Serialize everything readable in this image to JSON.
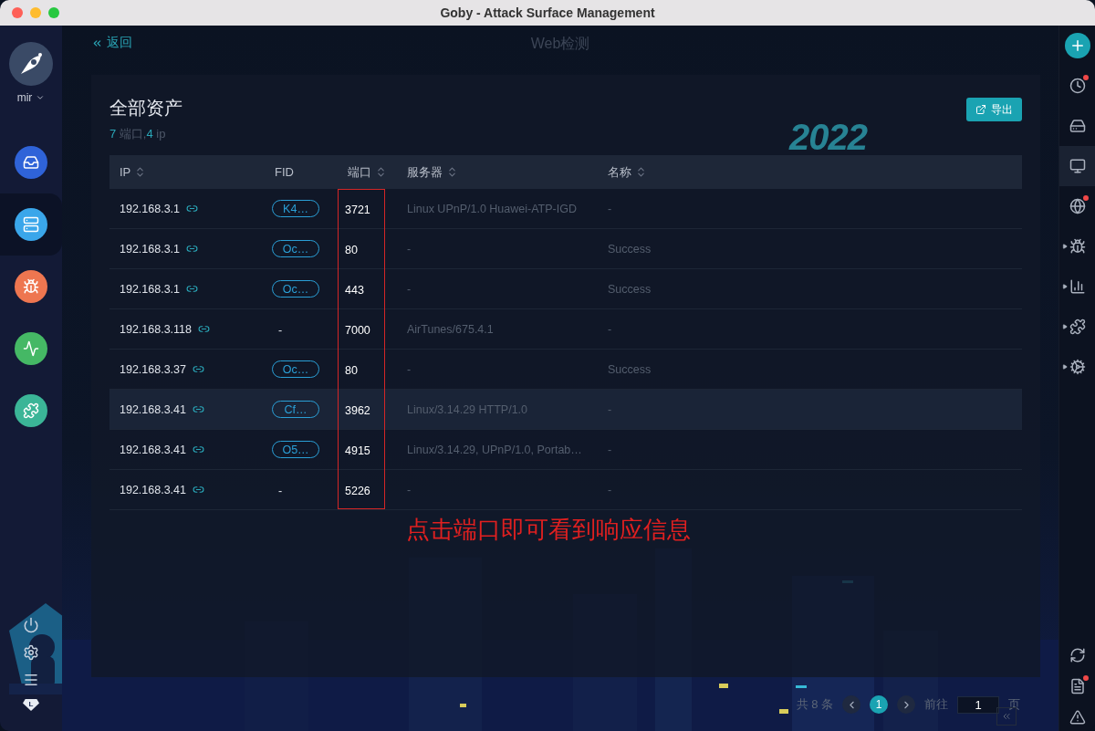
{
  "window": {
    "title": "Goby - Attack Surface Management"
  },
  "left_sidebar": {
    "user": {
      "name": "mir"
    },
    "nav": [
      {
        "kind": "scan",
        "color": "#2f63d8",
        "selected": false
      },
      {
        "kind": "assets",
        "color": "#3aa6ea",
        "selected": true
      },
      {
        "kind": "vuln",
        "color": "#ee7650",
        "selected": false
      },
      {
        "kind": "chart",
        "color": "#45b865",
        "selected": false
      },
      {
        "kind": "plugin",
        "color": "#3bb597",
        "selected": false
      }
    ],
    "badge": "L"
  },
  "header": {
    "back": "返回",
    "title": "Web检测"
  },
  "panel": {
    "title": "全部资产",
    "summary": {
      "port_count": "7",
      "port_label": "端口,",
      "ip_count": "4",
      "ip_label": "ip"
    },
    "export_button": "导出",
    "banner": "2022",
    "table": {
      "columns": [
        {
          "label": "IP",
          "sortable": true
        },
        {
          "label": "FID",
          "sortable": false
        },
        {
          "label": "端口",
          "sortable": true
        },
        {
          "label": "服务器",
          "sortable": true
        },
        {
          "label": "名称",
          "sortable": true
        }
      ],
      "rows": [
        {
          "ip": "192.168.3.1",
          "fid": "K4…",
          "port": "3721",
          "server": "Linux UPnP/1.0 Huawei-ATP-IGD",
          "name": "-",
          "selected": false
        },
        {
          "ip": "192.168.3.1",
          "fid": "Oc…",
          "port": "80",
          "server": "-",
          "name": "Success",
          "selected": false
        },
        {
          "ip": "192.168.3.1",
          "fid": "Oc…",
          "port": "443",
          "server": "-",
          "name": "Success",
          "selected": false
        },
        {
          "ip": "192.168.3.118",
          "fid": "-",
          "port": "7000",
          "server": "AirTunes/675.4.1",
          "name": "-",
          "selected": false
        },
        {
          "ip": "192.168.3.37",
          "fid": "Oc…",
          "port": "80",
          "server": "-",
          "name": "Success",
          "selected": false
        },
        {
          "ip": "192.168.3.41",
          "fid": "Cf…",
          "port": "3962",
          "server": "Linux/3.14.29 HTTP/1.0",
          "name": "-",
          "selected": true
        },
        {
          "ip": "192.168.3.41",
          "fid": "O5…",
          "port": "4915",
          "server": "Linux/3.14.29, UPnP/1.0, Portab…",
          "name": "-",
          "selected": false
        },
        {
          "ip": "192.168.3.41",
          "fid": "-",
          "port": "5226",
          "server": "-",
          "name": "-",
          "selected": false
        }
      ]
    },
    "annotation": "点击端口即可看到响应信息"
  },
  "pagination": {
    "total": "共 8 条",
    "pages": [
      {
        "label": "1",
        "selected": true
      }
    ],
    "goto_label": "前往",
    "goto_value": "1",
    "page_suffix": "页"
  },
  "right_sidebar": {
    "items": [
      {
        "kind": "add",
        "selected": false,
        "notification": false,
        "expandable": false
      },
      {
        "kind": "history",
        "selected": false,
        "notification": true,
        "expandable": false
      },
      {
        "kind": "server",
        "selected": false,
        "notification": false,
        "expandable": false
      },
      {
        "kind": "monitor",
        "selected": true,
        "notification": false,
        "expandable": false
      },
      {
        "kind": "ip",
        "selected": false,
        "notification": true,
        "expandable": false
      },
      {
        "kind": "bug",
        "selected": false,
        "notification": false,
        "expandable": true
      },
      {
        "kind": "stats",
        "selected": false,
        "notification": false,
        "expandable": true
      },
      {
        "kind": "plugin",
        "selected": false,
        "notification": false,
        "expandable": true
      },
      {
        "kind": "plugin-settings",
        "selected": false,
        "notification": false,
        "expandable": true
      }
    ],
    "bottom": [
      {
        "kind": "refresh",
        "notification": false
      },
      {
        "kind": "log",
        "notification": true
      },
      {
        "kind": "warning",
        "notification": false
      }
    ]
  }
}
